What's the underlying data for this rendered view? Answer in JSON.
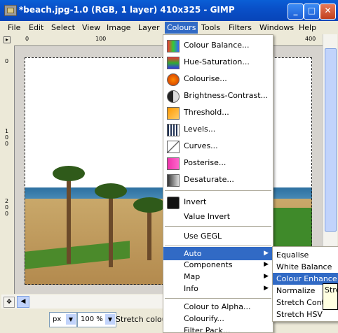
{
  "window": {
    "title": "*beach.jpg-1.0 (RGB, 1 layer) 410x325 - GIMP",
    "controls": {
      "minimize": "_",
      "maximize": "□",
      "close": "✕"
    }
  },
  "menubar": [
    "File",
    "Edit",
    "Select",
    "View",
    "Image",
    "Layer",
    "Colours",
    "Tools",
    "Filters",
    "Windows",
    "Help"
  ],
  "menubar_active": "Colours",
  "rulers": {
    "top": [
      "0",
      "100",
      "400"
    ],
    "left": [
      "0",
      "1\n0\n0",
      "2\n0\n0"
    ]
  },
  "colours_menu": {
    "items": [
      {
        "label": "Colour Balance...",
        "icon": "colour-balance-icon"
      },
      {
        "label": "Hue-Saturation...",
        "icon": "hue-saturation-icon"
      },
      {
        "label": "Colourise...",
        "icon": "colourise-icon"
      },
      {
        "label": "Brightness-Contrast...",
        "icon": "brightness-contrast-icon"
      },
      {
        "label": "Threshold...",
        "icon": "threshold-icon"
      },
      {
        "label": "Levels...",
        "icon": "levels-icon"
      },
      {
        "label": "Curves...",
        "icon": "curves-icon"
      },
      {
        "label": "Posterise...",
        "icon": "posterise-icon"
      },
      {
        "label": "Desaturate...",
        "icon": "desaturate-icon"
      },
      {
        "label": "Invert",
        "icon": "invert-icon"
      },
      {
        "label": "Value Invert",
        "icon": ""
      },
      {
        "label": "Use GEGL",
        "icon": ""
      },
      {
        "label": "Auto",
        "icon": "",
        "submenu": true
      },
      {
        "label": "Components",
        "icon": "",
        "submenu": true
      },
      {
        "label": "Map",
        "icon": "",
        "submenu": true
      },
      {
        "label": "Info",
        "icon": "",
        "submenu": true
      },
      {
        "label": "Colour to Alpha...",
        "icon": ""
      },
      {
        "label": "Colourify...",
        "icon": ""
      },
      {
        "label": "Filter Pack...",
        "icon": ""
      }
    ],
    "selected": "Auto"
  },
  "auto_menu": {
    "items": [
      "Equalise",
      "White Balance",
      "Colour Enhance",
      "Normalize",
      "Stretch Contrast",
      "Stretch HSV"
    ],
    "selected": "Colour Enhance"
  },
  "tooltip": "Stre",
  "statusbar": {
    "unit": "px",
    "zoom": "100 %",
    "message": "Stretch colour"
  },
  "colors": {
    "accent": "#316ac5",
    "titlebar": "#0a5fd6",
    "menu_bg": "#ffffff",
    "window_bg": "#ece9d8"
  }
}
